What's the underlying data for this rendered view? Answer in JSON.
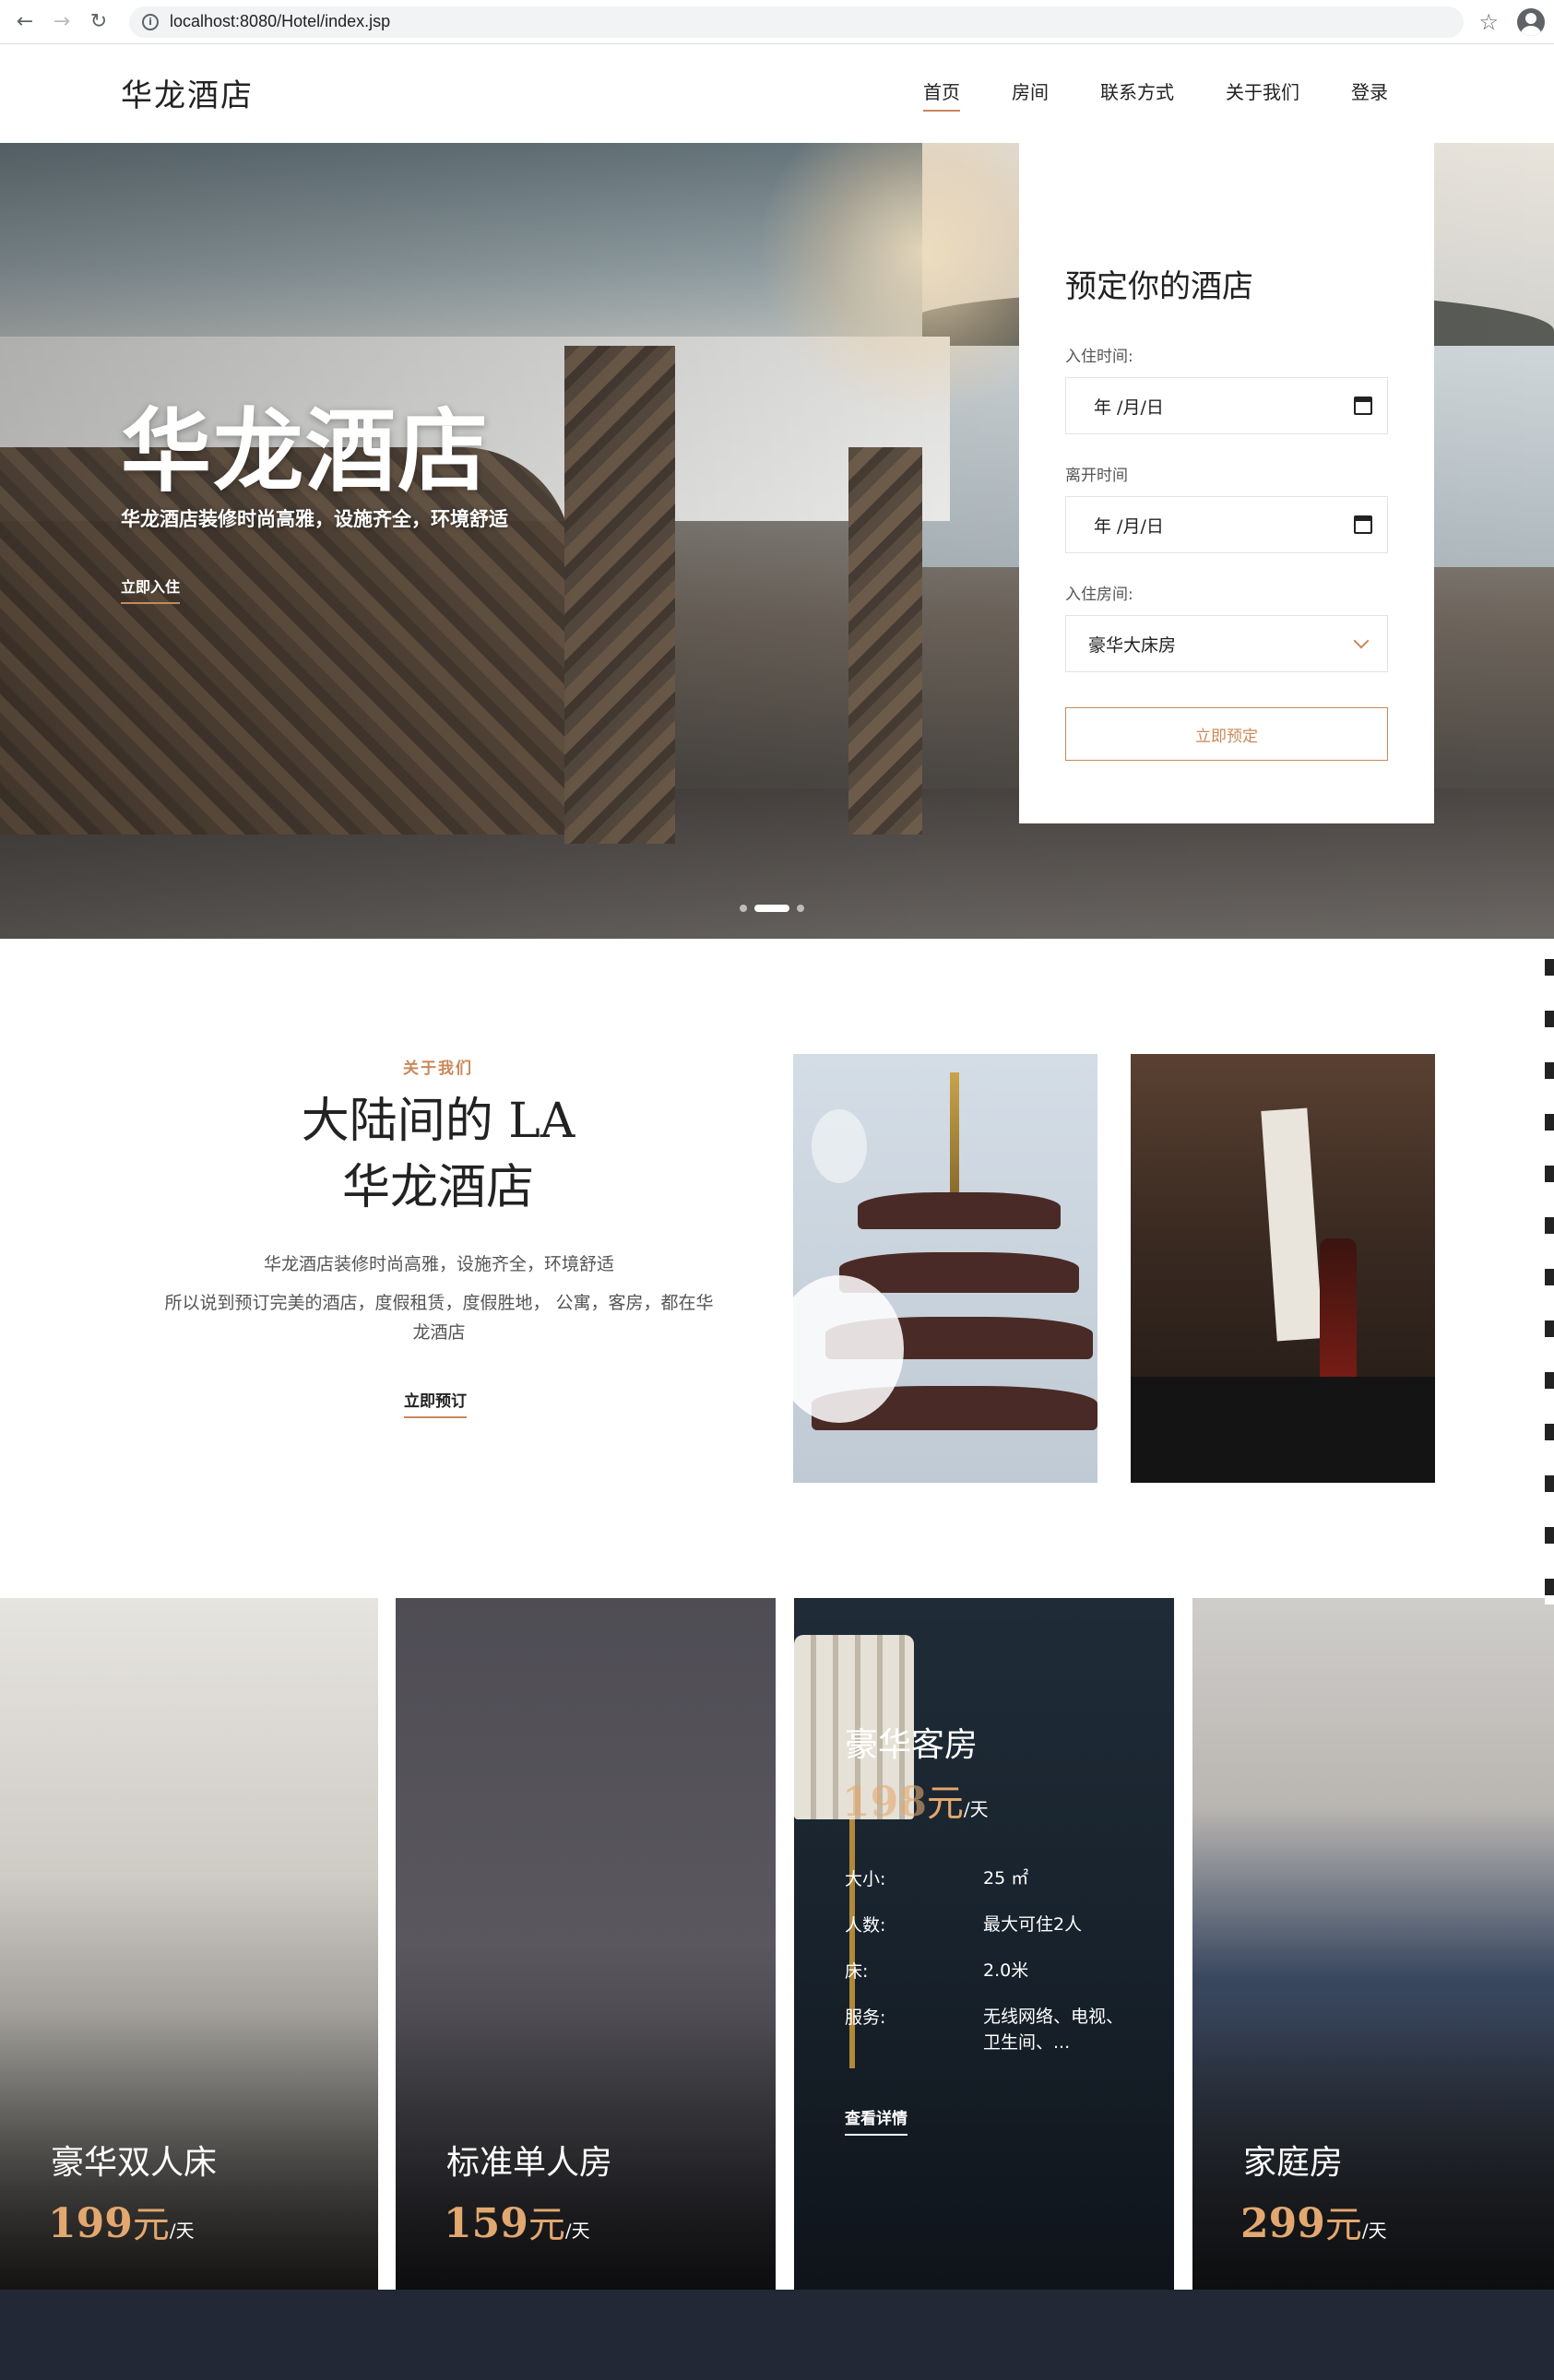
{
  "browser": {
    "url": "localhost:8080/Hotel/index.jsp",
    "back_icon": "←",
    "forward_icon": "→",
    "reload_icon": "↻",
    "info_icon": "i",
    "star_icon": "☆"
  },
  "header": {
    "logo": "华龙酒店",
    "nav": [
      {
        "label": "首页",
        "active": true
      },
      {
        "label": "房间",
        "active": false
      },
      {
        "label": "联系方式",
        "active": false
      },
      {
        "label": "关于我们",
        "active": false
      },
      {
        "label": "登录",
        "active": false
      }
    ]
  },
  "hero": {
    "title": "华龙酒店",
    "subtitle": "华龙酒店装修时尚高雅，设施齐全，环境舒适",
    "cta": "立即入住",
    "slides": 3,
    "active_slide": 2
  },
  "booking": {
    "title": "预定你的酒店",
    "checkin_label": "入住时间:",
    "checkin_value": "年 /月/日",
    "checkout_label": "离开时间",
    "checkout_value": "年 /月/日",
    "room_label": "入住房间:",
    "room_value": "豪华大床房",
    "submit": "立即预定"
  },
  "about": {
    "kicker": "关于我们",
    "title_line1": "大陆间的 LA",
    "title_line2": "华龙酒店",
    "text1": "华龙酒店装修时尚高雅，设施齐全，环境舒适",
    "text2": "所以说到预订完美的酒店，度假租赁，度假胜地， 公寓，客房，都在华龙酒店",
    "cta": "立即预订"
  },
  "rooms": [
    {
      "name": "豪华双人床",
      "price": "199",
      "unit": "元",
      "per": "/天"
    },
    {
      "name": "标准单人房",
      "price": "159",
      "unit": "元",
      "per": "/天"
    },
    {
      "name": "豪华客房",
      "price": "198",
      "unit": "元",
      "per": "/天",
      "specs": [
        {
          "k": "大小:",
          "v": "25 ㎡"
        },
        {
          "k": "人数:",
          "v": "最大可住2人"
        },
        {
          "k": "床:",
          "v": "2.0米"
        },
        {
          "k": "服务:",
          "v": "无线网络、电视、卫生间、..."
        }
      ],
      "detail": "查看详情"
    },
    {
      "name": "家庭房",
      "price": "299",
      "unit": "元",
      "per": "/天"
    }
  ],
  "colors": {
    "accent": "#c9885a",
    "price": "#e3a86f",
    "footer": "#232837"
  }
}
